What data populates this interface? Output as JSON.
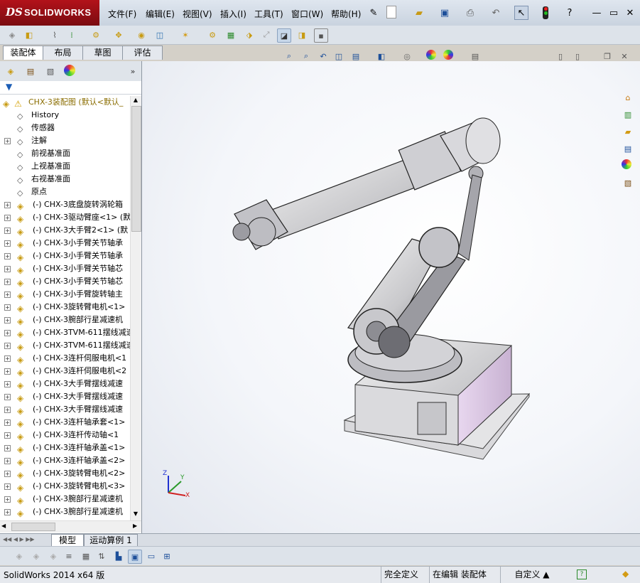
{
  "app": {
    "brand_ds": "DS",
    "brand_name": "SOLIDWORKS"
  },
  "menu": [
    "文件(F)",
    "编辑(E)",
    "视图(V)",
    "插入(I)",
    "工具(T)",
    "窗口(W)",
    "帮助(H)"
  ],
  "command_tabs": [
    "装配体",
    "布局",
    "草图",
    "评估"
  ],
  "tree": {
    "root": "CHX-3装配图  (默认<默认_",
    "items": [
      {
        "icon": "history-icon",
        "text": "History"
      },
      {
        "icon": "sensor-icon",
        "text": "传感器"
      },
      {
        "icon": "annotation-icon",
        "text": "注解",
        "expand": "+"
      },
      {
        "icon": "plane-icon",
        "text": "前视基准面"
      },
      {
        "icon": "plane-icon",
        "text": "上视基准面"
      },
      {
        "icon": "plane-icon",
        "text": "右视基准面"
      },
      {
        "icon": "origin-icon",
        "text": "原点"
      }
    ],
    "parts": [
      "(-) CHX-3底盘旋转涡轮箱",
      "(-) CHX-3驱动臂座<1> (默",
      "(-) CHX-3大手臂2<1> (默",
      "(-) CHX-3小手臂关节轴承",
      "(-) CHX-3小手臂关节轴承",
      "(-) CHX-3小手臂关节轴芯",
      "(-) CHX-3小手臂关节轴芯",
      "(-) CHX-3小手臂旋转轴主",
      "(-) CHX-3旋转臂电机<1>",
      "(-) CHX-3腕部行星减速机",
      "(-) CHX-3TVM-611摆线减速",
      "(-) CHX-3TVM-611摆线减速",
      "(-) CHX-3连杆伺服电机<1",
      "(-) CHX-3连杆伺服电机<2",
      "(-) CHX-3大手臂摆线减速",
      "(-) CHX-3大手臂摆线减速",
      "(-) CHX-3大手臂摆线减速",
      "(-) CHX-3连杆轴承套<1>",
      "(-) CHX-3连杆传动轴<1",
      "(-) CHX-3连杆轴承盖<1>",
      "(-) CHX-3连杆轴承盖<2>",
      "(-) CHX-3旋转臂电机<2>",
      "(-) CHX-3旋转臂电机<3>",
      "(-) CHX-3腕部行星减速机",
      "(-) CHX-3腕部行星减速机"
    ]
  },
  "bottom_tabs": [
    "模型",
    "运动算例 1"
  ],
  "status": {
    "version": "SolidWorks 2014 x64 版",
    "defined": "完全定义",
    "editing": "在编辑 装配体",
    "custom": "自定义"
  },
  "triad": {
    "z": "Z",
    "y": "Y",
    "x": "X"
  },
  "colors": {
    "brand": "#b3121a",
    "panel": "#ffffff",
    "toolbar": "#dde3ea"
  }
}
